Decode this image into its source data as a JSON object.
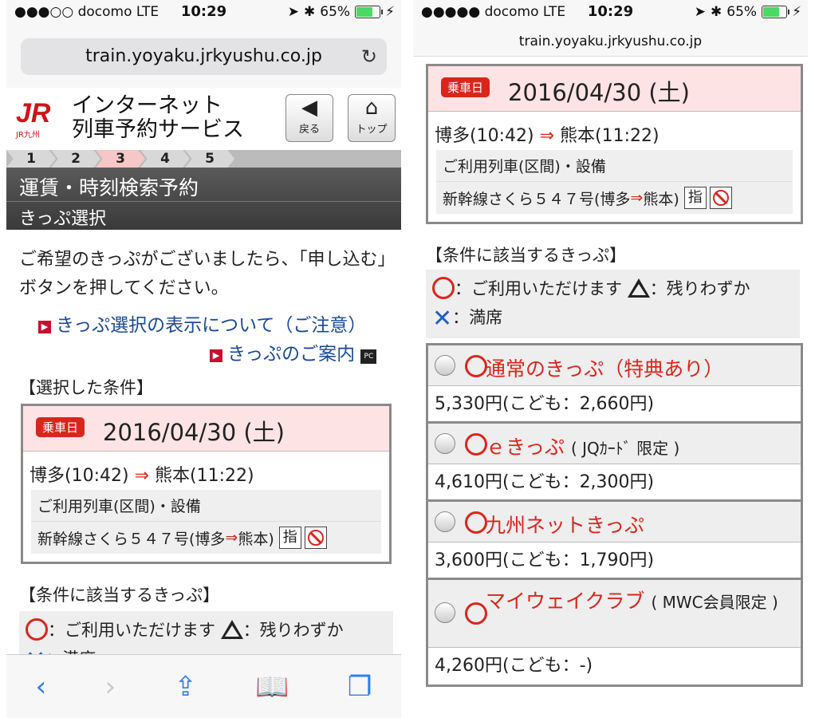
{
  "status": {
    "carrier_left": "●●●○○ docomo  LTE",
    "carrier_right": "●●●●● docomo  LTE",
    "time": "10:29",
    "battery": "65%"
  },
  "url": "train.yoyaku.jrkyushu.co.jp",
  "header": {
    "logo": "JR",
    "logo_sub": "JR九州",
    "title_line1": "インターネット",
    "title_line2": "列車予約サービス",
    "back_label": "戻る",
    "top_label": "トップ"
  },
  "steps": [
    "1",
    "2",
    "3",
    "4",
    "5"
  ],
  "page": {
    "title": "運賃・時刻検索予約",
    "subtitle": "きっぷ選択"
  },
  "intro": "ご希望のきっぷがございましたら、「申し込む」ボタンを押してください。",
  "links": {
    "notice": "きっぷ選択の表示について（ご注意）",
    "guide": "きっぷのご案内"
  },
  "selected_label": "【選択した条件】",
  "condition": {
    "badge": "乗車日",
    "date": "2016/04/30 (土)",
    "from": "博多(10:42)",
    "arrow": "⇒",
    "to": "熊本(11:22)",
    "train_header": "ご利用列車(区間)・設備",
    "train_name": "新幹線さくら５４７号(博多",
    "train_to": "熊本)",
    "reserved": "指"
  },
  "tickets_label": "【条件に該当するきっぷ】",
  "legend": {
    "available": "：ご利用いただけます",
    "few": "：残りわずか",
    "full": "：満席",
    "full_partial": "：満席"
  },
  "tickets": [
    {
      "name": "通常のきっぷ（特典あり）",
      "note": "",
      "price": "5,330円(こども：2,660円)"
    },
    {
      "name": "ｅきっぷ",
      "note": "( JQｶｰﾄﾞ 限定 )",
      "price": "4,610円(こども：2,300円)"
    },
    {
      "name": "九州ネットきっぷ",
      "note": "",
      "price": "3,600円(こども：1,790円)"
    },
    {
      "name": "マイウェイクラブ",
      "note": "( MWC会員限定 )",
      "price": "4,260円(こども：-)"
    }
  ]
}
